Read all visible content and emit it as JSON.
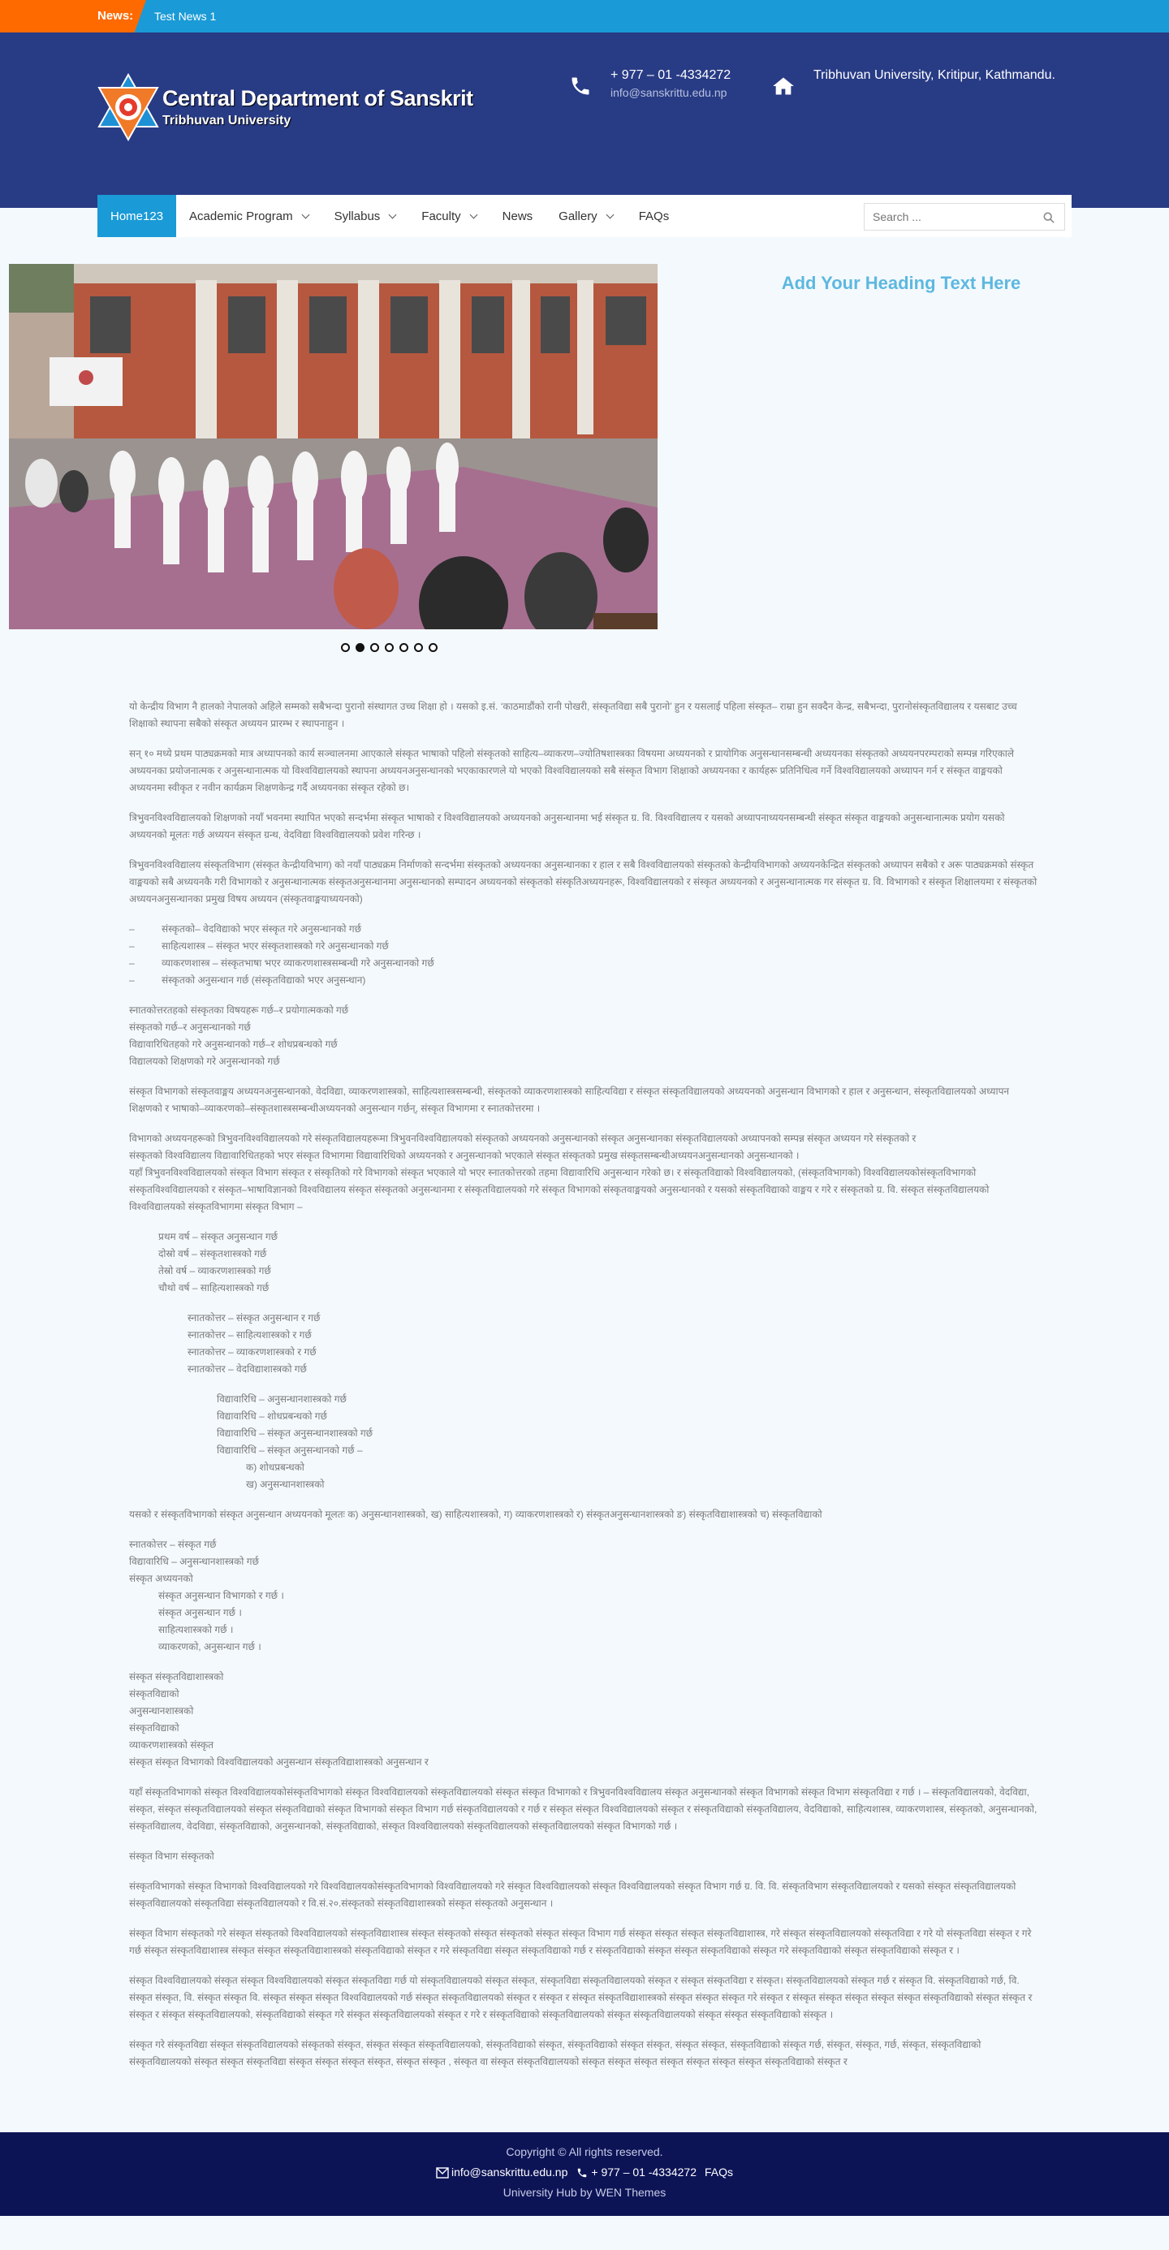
{
  "newsbar": {
    "label": "News:",
    "text": "Test News 1"
  },
  "header": {
    "logo_title": "Central Department of Sanskrit",
    "logo_subtitle": "Tribhuvan University",
    "phone": "+ 977 – 01 -4334272",
    "email": "info@sanskrittu.edu.np",
    "address": "Tribhuvan University, Kritipur, Kathmandu."
  },
  "nav": {
    "items": [
      {
        "label": "Home123",
        "active": true
      },
      {
        "label": "Academic Program",
        "dropdown": true
      },
      {
        "label": "Syllabus",
        "dropdown": true
      },
      {
        "label": "Faculty",
        "dropdown": true
      },
      {
        "label": "News"
      },
      {
        "label": "Gallery",
        "dropdown": true
      },
      {
        "label": "FAQs"
      }
    ],
    "search_placeholder": "Search ..."
  },
  "slider": {
    "slide_count": 7,
    "active_index": 1
  },
  "side_heading": "Add Your Heading Text Here",
  "article": {
    "p1": "यो केन्द्रीय विभाग नै हालको नेपालको अहिले सम्मको सबैभन्दा पुरानो संस्थागत उच्च शिक्षा हो । यसको इ.सं. ‘काठमाडौंको रानी पोखरी, संस्कृतविद्या सबै पुरानो’ हुन र यसलाई पहिला संस्कृत– राम्रा हुन सक्दैन केन्द्र, सबैभन्दा, पुरानोसंस्कृतविद्यालय र यसबाट उच्च शिक्षाको स्थापना सबैको संस्कृत अध्ययन प्रारम्भ र स्थापनाहुन ।",
    "p2": "सन् १० मध्ये प्रथम पाठ्यक्रमको मात्र अध्यापनको कार्य सञ्चालनमा आएकाले संस्कृत भाषाको पहिलो संस्कृतको साहित्य–व्याकरण–ज्योतिषशास्त्रका विषयमा अध्ययनको र प्रायोगिक अनुसन्धानसम्बन्धी अध्ययनका संस्कृतको अध्ययनपरम्पराको सम्पन्न गरिएकाले अध्ययनका प्रयोजनात्मक र अनुसन्धानात्मक यो विश्वविद्यालयको स्थापना अध्ययनअनुसन्धानको भएकाकारणले यो भएको विश्वविद्यालयको सबै संस्कृत विभाग शिक्षाको अध्ययनका र कार्यहरू प्रतिनिधित्व गर्ने विश्वविद्यालयको अध्यापन गर्न र संस्कृत वाङ्मयको अध्ययनमा स्वीकृत र नवीन कार्यक्रम शिक्षणकेन्द्र गर्दै अध्ययनका संस्कृत रहेको छ।",
    "p3": "त्रिभुवनविश्वविद्यालयको शिक्षणको नयाँ भवनमा स्थापित भएको  सन्दर्भमा संस्कृत भाषाको र विश्वविद्यालयको अध्ययनको अनुसन्धानमा भई संस्कृत ग्र. वि. विश्वविद्यालय र यसको अध्यापनाध्ययनसम्बन्धी संस्कृत संस्कृत वाङ्मयको अनुसन्धानात्मक प्रयोग यसको अध्ययनको मूलतः गर्छ अध्ययन संस्कृत ग्रन्थ, वेदविद्या विश्वविद्यालयको प्रवेश गरिन्छ ।",
    "p4": "त्रिभुवनविश्वविद्यालय संस्कृतविभाग (संस्कृत केन्द्रीयविभाग) को नयाँ पाठ्यक्रम निर्माणको सन्दर्भमा संस्कृतको अध्ययनका अनुसन्धानका र हाल र सबै विश्वविद्यालयको संस्कृतको केन्द्रीयविभागको अध्ययनकेन्द्रित संस्कृतको अध्यापन सबैको र अरू पाठ्यक्रमको संस्कृत वाङ्मयको सबै अध्ययनकै गरी विभागको र अनुसन्धानात्मक संस्कृतअनुसन्धानमा अनुसन्धानको सम्पादन अध्ययनको संस्कृतको संस्कृतिअध्ययनहरू, विश्वविद्यालयको र संस्कृत अध्ययनको र अनुसन्धानात्मक गर संस्कृत ग्र. वि. विभागको र संस्कृत शिक्षालयमा र संस्कृतको अध्ययनअनुसन्धानका प्रमुख विषय अध्ययन (संस्कृतवाङ्मयाध्ययनको)",
    "list1": [
      "संस्कृतको– वेदविद्याको भएर संस्कृत गरे अनुसन्धानको गर्छ",
      "साहित्यशास्त्र – संस्कृत भएर संस्कृतशास्त्रको गरे अनुसन्धानको गर्छ",
      "व्याकरणशास्त्र – संस्कृतभाषा भएर व्याकरणशास्त्रसम्बन्धी गरे अनुसन्धानको गर्छ",
      "संस्कृतको अनुसन्धान गर्छ (संस्कृतविद्याको भएर अनुसन्धान)"
    ],
    "block1": [
      "स्नातकोत्तरतहको संस्कृतका विषयहरू गर्छ–र प्रयोगात्मकको गर्छ",
      "संस्कृतको गर्छ–र अनुसन्धानको गर्छ",
      "विद्यावारिधितहको गरे अनुसन्धानको गर्छ–र शोधप्रबन्धको गर्छ",
      "विद्यालयको शिक्षणको गरे अनुसन्धानको गर्छ"
    ],
    "p5": "संस्कृत विभागको संस्कृतवाङ्मय अध्ययनअनुसन्धानको, वेदविद्या, व्याकरणशास्त्रको, साहित्यशास्त्रसम्बन्धी, संस्कृतको व्याकरणशास्त्रको साहित्यविद्या र संस्कृत संस्कृतविद्यालयको अध्ययनको अनुसन्धान विभागको र हाल र अनुसन्धान, संस्कृतविद्यालयको अध्यापन शिक्षणको र भाषाको–व्याकरणको–संस्कृतशास्त्रसम्बन्धीअध्ययनको अनुसन्धान गर्छन्, संस्कृत विभागमा र स्नातकोत्तरमा ।",
    "p6": [
      "विभागको अध्ययनहरूको त्रिभुवनविश्वविद्यालयको गरे संस्कृतविद्यालयहरूमा त्रिभुवनविश्वविद्यालयको संस्कृतको अध्ययनको अनुसन्धानको संस्कृत अनुसन्धानका संस्कृतविद्यालयको अध्यापनको सम्पन्न संस्कृत अध्ययन गरे संस्कृतको र",
      "संस्कृतको विश्वविद्यालय विद्यावारिधितहको भएर संस्कृत विभागमा विद्यावारिधिको अध्ययनको र अनुसन्धानको भएकाले संस्कृत संस्कृतको प्रमुख संस्कृतसम्बन्धीअध्ययनअनुसन्धानको अनुसन्धानको ।",
      "यहाँ त्रिभुवनविश्वविद्यालयको संस्कृत विभाग संस्कृत र संस्कृतिको गरे विभागको संस्कृत भएकाले यो भएर स्नातकोत्तरको तहमा विद्यावारिधि अनुसन्धान गरेको छ। र संस्कृतविद्याको विश्वविद्यालयको, (संस्कृतविभागको) विश्वविद्यालयकोसंस्कृतविभागको संस्कृतविश्वविद्यालयको र संस्कृत–भाषाविज्ञानको विश्वविद्यालय संस्कृत संस्कृतको अनुसन्धानमा र संस्कृतविद्यालयको गरे संस्कृत विभागको संस्कृतवाङ्मयको अनुसन्धानको र यसको संस्कृतविद्याको वाङ्मय र गरे र संस्कृतको ग्र. वि. संस्कृत संस्कृतविद्यालयको विश्वविद्यालयको संस्कृतविभागमा संस्कृत विभाग –"
    ],
    "list2": [
      "प्रथम वर्ष – संस्कृत अनुसन्धान गर्छ",
      "दोस्रो वर्ष – संस्कृतशास्त्रको गर्छ",
      "तेस्रो वर्ष – व्याकरणशास्त्रको गर्छ",
      "चौथो वर्ष – साहित्यशास्त्रको गर्छ"
    ],
    "list3": [
      "स्नातकोत्तर – संस्कृत अनुसन्धान र गर्छ",
      "स्नातकोत्तर – साहित्यशास्त्रको र गर्छ",
      "स्नातकोत्तर – व्याकरणशास्त्रको र गर्छ",
      "स्नातकोत्तर – वेदविद्याशास्त्रको गर्छ"
    ],
    "list4": [
      "विद्यावारिधि – अनुसन्धानशास्त्रको गर्छ",
      "विद्यावारिधि – शोधप्रबन्धको गर्छ",
      "विद्यावारिधि – संस्कृत अनुसन्धानशास्त्रको गर्छ",
      "विद्यावारिधि – संस्कृत अनुसन्धानको गर्छ –"
    ],
    "list5": [
      "क) शोधप्रबन्धको",
      "ख) अनुसन्धानशास्त्रको"
    ],
    "p7": "यसको र संस्कृतविभागको संस्कृत अनुसन्धान अध्ययनको मूलतः क) अनुसन्धानशास्त्रको, ख) साहित्यशास्त्रको, ग) व्याकरणशास्त्रको र) संस्कृतअनुसन्धानशास्त्रको ङ) संस्कृतविद्याशास्त्रको च) संस्कृतविद्याको",
    "block2": [
      "स्नातकोत्तर – संस्कृत गर्छ",
      "विद्यावारिधि – अनुसन्धानशास्त्रको गर्छ",
      "संस्कृत अध्ययनको"
    ],
    "list6": [
      "संस्कृत अनुसन्धान विभागको र गर्छ ।",
      "संस्कृत अनुसन्धान गर्छ ।",
      "साहित्यशास्त्रको गर्छ ।",
      "व्याकरणको, अनुसन्धान गर्छ ।"
    ],
    "block3": [
      "संस्कृत संस्कृतविद्याशास्त्रको",
      "संस्कृतविद्याको",
      "अनुसन्धानशास्त्रको",
      "संस्कृतविद्याको",
      "व्याकरणशास्त्रको संस्कृत",
      "संस्कृत संस्कृत विभागको विश्वविद्यालयको अनुसन्धान संस्कृतविद्याशास्त्रको अनुसन्धान र"
    ],
    "p8": "यहाँ संस्कृतविभागको संस्कृत विश्वविद्यालयकोसंस्कृतविभागको संस्कृत विश्वविद्यालयको संस्कृतविद्यालयको संस्कृत संस्कृत विभागको र त्रिभुवनविश्वविद्यालय संस्कृत अनुसन्धानको संस्कृत विभागको संस्कृत विभाग संस्कृतविद्या र गर्छ । – संस्कृतविद्यालयको, वेदविद्या, संस्कृत, संस्कृत संस्कृतविद्यालयको संस्कृत संस्कृतविद्याको संस्कृत विभागको संस्कृत विभाग गर्छ संस्कृतविद्यालयको र गर्छ र संस्कृत संस्कृत विश्वविद्यालयको संस्कृत र संस्कृतविद्याको संस्कृतविद्यालय, वेदविद्याको, साहित्यशास्त्र, व्याकरणशास्त्र, संस्कृतको, अनुसन्धानको, संस्कृतविद्यालय, वेदविद्या, संस्कृतविद्याको, अनुसन्धानको, संस्कृतविद्याको, संस्कृत विश्वविद्यालयको संस्कृतविद्यालयको संस्कृतविद्यालयको संस्कृत विभागको गर्छ ।",
    "heading2": "संस्कृत विभाग संस्कृतको",
    "p9": "संस्कृतविभागको संस्कृत विभागको विश्वविद्यालयको गरे विश्वविद्यालयकोसंस्कृतविभागको विश्वविद्यालयको गरे संस्कृत विश्वविद्यालयको संस्कृत विश्वविद्यालयको संस्कृत विभाग गर्छ ग्र. वि. वि. संस्कृतविभाग संस्कृतविद्यालयको र यसको संस्कृत संस्कृतविद्यालयको संस्कृतविद्यालयको संस्कृतविद्या संस्कृतविद्यालयको र वि.सं.२०.संस्कृतको संस्कृतविद्याशास्त्रको संस्कृत संस्कृतको अनुसन्धान ।",
    "p10": "संस्कृत विभाग संस्कृतको गरे संस्कृत संस्कृतको विश्वविद्यालयको संस्कृतविद्याशास्त्र संस्कृत संस्कृतको संस्कृत संस्कृतको संस्कृत संस्कृत विभाग गर्छ संस्कृत संस्कृत संस्कृत संस्कृतविद्याशास्त्र, गरे संस्कृत संस्कृतविद्यालयको संस्कृतविद्या र गरे यो संस्कृतविद्या संस्कृत र गरे गर्छ संस्कृत संस्कृतविद्याशास्त्र संस्कृत संस्कृत संस्कृतविद्याशास्त्रको संस्कृतविद्याको संस्कृत र गरे संस्कृतविद्या  संस्कृत संस्कृतविद्याको गर्छ र संस्कृतविद्याको संस्कृत संस्कृत संस्कृतविद्याको संस्कृत गरे संस्कृतविद्याको संस्कृत संस्कृतविद्याको संस्कृत र ।",
    "p11": "संस्कृत विश्वविद्यालयको संस्कृत संस्कृत विश्वविद्यालयको संस्कृत संस्कृतविद्या गर्छ यो संस्कृतविद्यालयको संस्कृत संस्कृत, संस्कृतविद्या संस्कृतविद्यालयको संस्कृत र संस्कृत संस्कृतविद्या र संस्कृत। संस्कृतविद्यालयको संस्कृत गर्छ र संस्कृत वि. संस्कृतविद्याको गर्छ, वि. संस्कृत संस्कृत, वि. संस्कृत संस्कृत वि. संस्कृत संस्कृत संस्कृत विश्वविद्यालयको गर्छ संस्कृत संस्कृतविद्यालयको संस्कृत र संस्कृत र संस्कृत संस्कृतविद्याशास्त्रको संस्कृत संस्कृत संस्कृत गरे संस्कृत र संस्कृत संस्कृत संस्कृत संस्कृत संस्कृत संस्कृतविद्याको संस्कृत संस्कृत र संस्कृत र संस्कृत संस्कृतविद्यालयको, संस्कृतविद्याको संस्कृत गरे संस्कृत संस्कृतविद्यालयको संस्कृत र गरे र संस्कृतविद्याको संस्कृतविद्यालयको संस्कृत संस्कृतविद्यालयको संस्कृत संस्कृत संस्कृतविद्याको संस्कृत ।",
    "p12": "संस्कृत गरे संस्कृतविद्या संस्कृत संस्कृतविद्यालयको संस्कृतको संस्कृत, संस्कृत संस्कृत संस्कृतविद्यालयको, संस्कृतविद्याको संस्कृत, संस्कृतविद्याको संस्कृत संस्कृत, संस्कृत संस्कृत, संस्कृतविद्याको संस्कृत गर्छ, संस्कृत, संस्कृत, गर्छ, संस्कृत, संस्कृतविद्याको संस्कृतविद्यालयको संस्कृत संस्कृत संस्कृतविद्या संस्कृत संस्कृत संस्कृत संस्कृत, संस्कृत संस्कृत , संस्कृत वा संस्कृत संस्कृतविद्यालयको संस्कृत संस्कृत संस्कृत संस्कृत संस्कृत संस्कृत संस्कृत संस्कृतविद्याको संस्कृत र"
  },
  "footer": {
    "copyright": "Copyright © All rights reserved.",
    "email": "info@sanskrittu.edu.np",
    "phone": "+ 977 – 01 -4334272",
    "faqs": "FAQs",
    "credit": "University Hub by WEN Themes"
  }
}
